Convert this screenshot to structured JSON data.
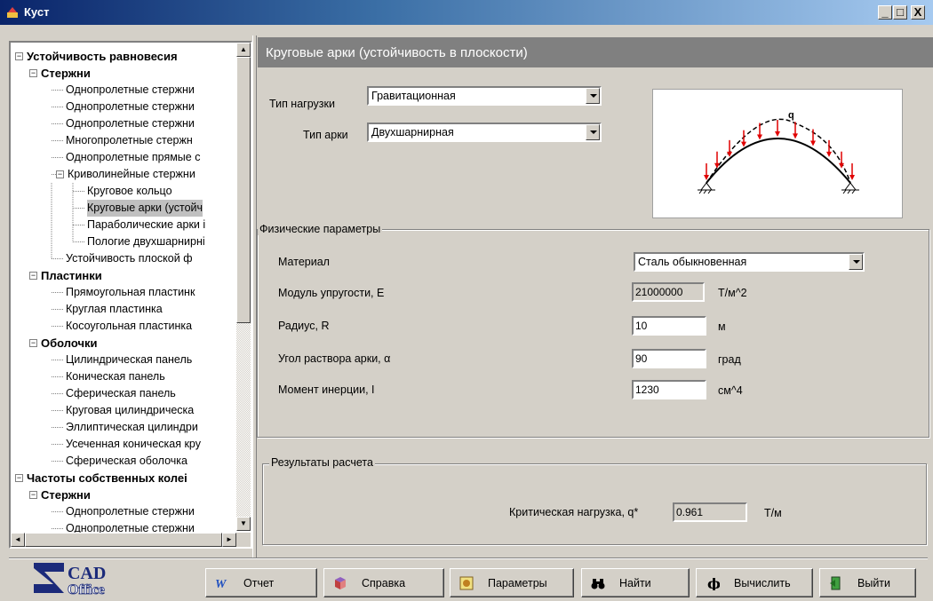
{
  "window": {
    "title": "Куст",
    "minimize": "_",
    "maximize": "□",
    "close": "X"
  },
  "tree": {
    "items": [
      {
        "label": "Устойчивость равновесия",
        "level": 0,
        "bold": true,
        "expander": "−"
      },
      {
        "label": "Стержни",
        "level": 1,
        "bold": true,
        "expander": "−"
      },
      {
        "label": "Однопролетные стержни",
        "level": 2
      },
      {
        "label": "Однопролетные стержни",
        "level": 2
      },
      {
        "label": "Однопролетные стержни",
        "level": 2
      },
      {
        "label": "Многопролетные стержн",
        "level": 2
      },
      {
        "label": "Однопролетные прямые с",
        "level": 2
      },
      {
        "label": "Криволинейные стержни",
        "level": 2,
        "expander": "−"
      },
      {
        "label": "Круговое кольцо",
        "level": 3
      },
      {
        "label": "Круговые арки (устойч",
        "level": 3,
        "selected": true
      },
      {
        "label": "Параболические арки і",
        "level": 3
      },
      {
        "label": "Пологие двухшарнирні",
        "level": 3
      },
      {
        "label": "Устойчивость плоской ф",
        "level": 2
      },
      {
        "label": "Пластинки",
        "level": 1,
        "bold": true,
        "expander": "−"
      },
      {
        "label": "Прямоугольная пластинк",
        "level": 2
      },
      {
        "label": "Круглая пластинка",
        "level": 2
      },
      {
        "label": "Косоугольная пластинка",
        "level": 2
      },
      {
        "label": "Оболочки",
        "level": 1,
        "bold": true,
        "expander": "−"
      },
      {
        "label": "Цилиндрическая панель",
        "level": 2
      },
      {
        "label": "Коническая панель",
        "level": 2
      },
      {
        "label": "Сферическая панель",
        "level": 2
      },
      {
        "label": "Круговая цилиндрическа",
        "level": 2
      },
      {
        "label": "Эллиптическая цилиндри",
        "level": 2
      },
      {
        "label": "Усеченная коническая кру",
        "level": 2
      },
      {
        "label": "Сферическая оболочка",
        "level": 2
      },
      {
        "label": "Частоты собственных колеі",
        "level": 0,
        "bold": true,
        "expander": "−"
      },
      {
        "label": "Стержни",
        "level": 1,
        "bold": true,
        "expander": "−"
      },
      {
        "label": "Однопролетные стержни",
        "level": 2
      },
      {
        "label": "Однопролетные стержни",
        "level": 2
      }
    ],
    "scroll_up": "▲",
    "scroll_down": "▼",
    "scroll_left": "◄",
    "scroll_right": "►"
  },
  "header": {
    "title": "Круговые арки (устойчивость в плоскости)"
  },
  "load": {
    "label": "Тип нагрузки",
    "value": "Гравитационная"
  },
  "arch": {
    "label": "Тип арки",
    "value": "Двухшарнирная"
  },
  "diagram": {
    "load_symbol": "q"
  },
  "physical": {
    "title": "Физические параметры",
    "material": {
      "label": "Материал",
      "value": "Сталь обыкновенная"
    },
    "modulus": {
      "label": "Модуль упругости, E",
      "value": "21000000",
      "unit": "Т/м^2"
    },
    "radius": {
      "label": "Радиус, R",
      "value": "10",
      "unit": "м"
    },
    "angle": {
      "label": "Угол раствора арки, α",
      "value": "90",
      "unit": "град"
    },
    "inertia": {
      "label": "Момент инерции, I",
      "value": "1230",
      "unit": "см^4"
    }
  },
  "results": {
    "title": "Результаты расчета",
    "critical": {
      "label": "Критическая нагрузка, q*",
      "value": "0.961",
      "unit": "Т/м"
    }
  },
  "logo": {
    "text_top": "CAD",
    "text_bottom": "Office"
  },
  "toolbar": {
    "report": "Отчет",
    "help": "Справка",
    "params": "Параметры",
    "find": "Найти",
    "calculate": "Вычислить",
    "exit": "Выйти"
  },
  "colors": {
    "titlebar": "#0a246a",
    "arrow": "#e00000",
    "face": "#d4d0c8",
    "header": "#808080"
  }
}
